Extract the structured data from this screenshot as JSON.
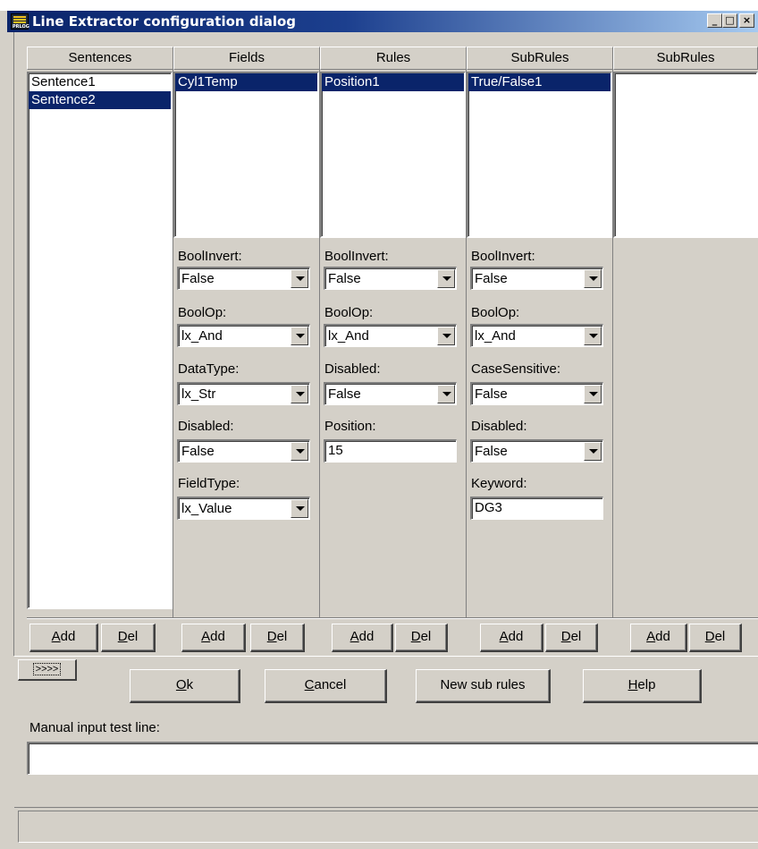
{
  "window": {
    "title": "Line Extractor configuration dialog",
    "icon_text": "PRLOG",
    "minimize_glyph": "_",
    "maximize_glyph": "□",
    "close_glyph": "×"
  },
  "columns": {
    "sentences": {
      "header": "Sentences",
      "items": [
        "Sentence1",
        "Sentence2"
      ],
      "selected": "Sentence2"
    },
    "fields": {
      "header": "Fields",
      "items": [
        "Cyl1Temp"
      ],
      "selected": "Cyl1Temp"
    },
    "rules": {
      "header": "Rules",
      "items": [
        "Position1"
      ],
      "selected": "Position1"
    },
    "subrules1": {
      "header": "SubRules",
      "items": [
        "True/False1"
      ],
      "selected": "True/False1"
    },
    "subrules2": {
      "header": "SubRules",
      "items": []
    }
  },
  "fields_props": {
    "boolinvert_label": "BoolInvert:",
    "boolinvert_value": "False",
    "boolop_label": "BoolOp:",
    "boolop_value": "lx_And",
    "datatype_label": "DataType:",
    "datatype_value": "lx_Str",
    "disabled_label": "Disabled:",
    "disabled_value": "False",
    "fieldtype_label": "FieldType:",
    "fieldtype_value": "lx_Value"
  },
  "rules_props": {
    "boolinvert_label": "BoolInvert:",
    "boolinvert_value": "False",
    "boolop_label": "BoolOp:",
    "boolop_value": "lx_And",
    "disabled_label": "Disabled:",
    "disabled_value": "False",
    "position_label": "Position:",
    "position_value": "15"
  },
  "subrules_props": {
    "boolinvert_label": "BoolInvert:",
    "boolinvert_value": "False",
    "boolop_label": "BoolOp:",
    "boolop_value": "lx_And",
    "casesensitive_label": "CaseSensitive:",
    "casesensitive_value": "False",
    "disabled_label": "Disabled:",
    "disabled_value": "False",
    "keyword_label": "Keyword:",
    "keyword_value": "DG3"
  },
  "column_buttons": {
    "add_access": "A",
    "add_rest": "dd",
    "del_access": "D",
    "del_rest": "el"
  },
  "actions": {
    "expand_label": ">>>>",
    "ok_access": "O",
    "ok_rest": "k",
    "cancel_access": "C",
    "cancel_rest": "ancel",
    "new_sub_rules": "New sub rules",
    "help_access": "H",
    "help_rest": "elp"
  },
  "manual_input": {
    "label": "Manual input test line:",
    "value": ""
  },
  "status_bar": {
    "text": ""
  }
}
